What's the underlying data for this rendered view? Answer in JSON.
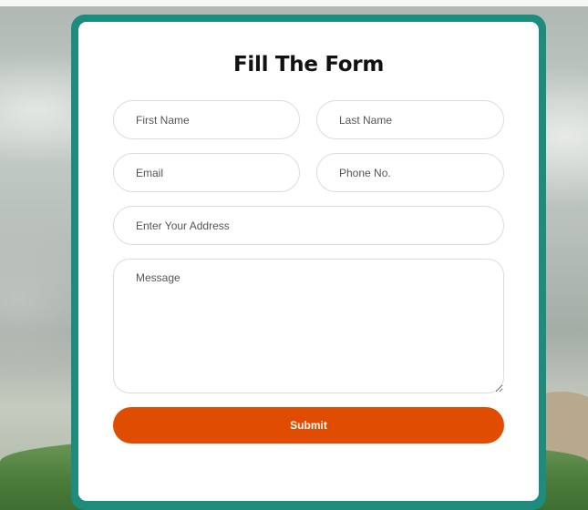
{
  "form": {
    "title": "Fill The Form",
    "first_name_placeholder": "First Name",
    "last_name_placeholder": "Last Name",
    "email_placeholder": "Email",
    "phone_placeholder": "Phone No.",
    "address_placeholder": "Enter Your Address",
    "message_placeholder": "Message",
    "submit_label": "Submit"
  },
  "colors": {
    "card_border": "#1d8c7c",
    "submit_background": "#e04d00",
    "submit_text": "#ffffff",
    "title_text": "#111111"
  }
}
